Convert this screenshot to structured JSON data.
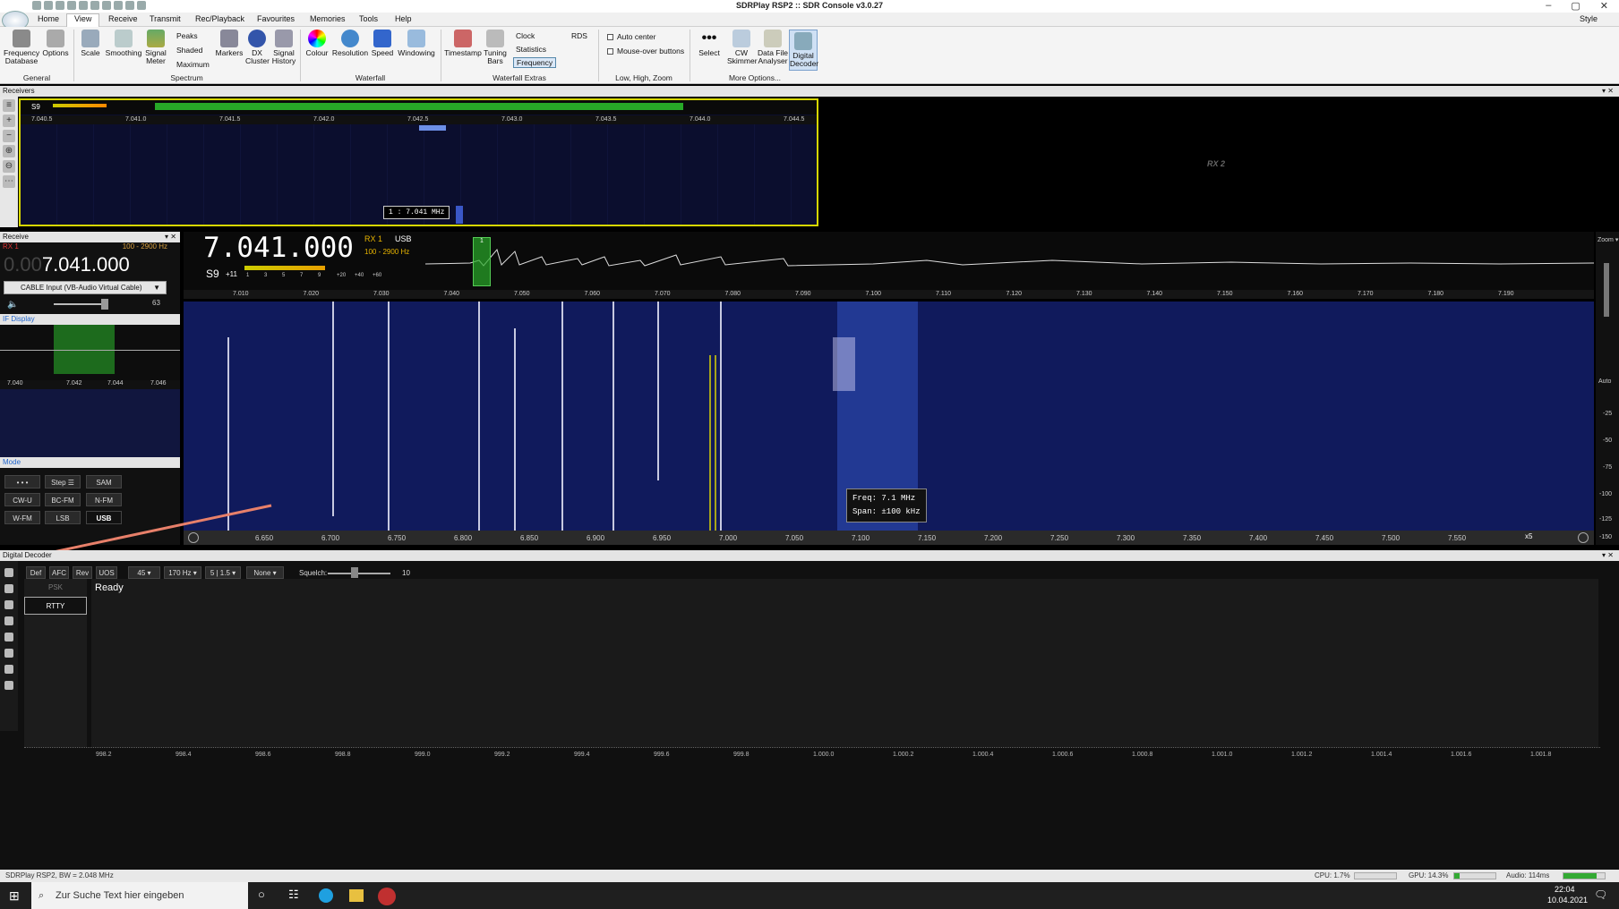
{
  "window": {
    "title": "SDRPlay RSP2 :: SDR Console v3.0.27"
  },
  "menu": {
    "tabs": [
      "Home",
      "View",
      "Receive",
      "Transmit",
      "Rec/Playback",
      "Favourites",
      "Memories",
      "Tools",
      "Help"
    ],
    "active": "View",
    "style_label": "Style"
  },
  "ribbon": {
    "buttons": [
      {
        "label": "Frequency\nDatabase",
        "icon": "database-icon"
      },
      {
        "label": "Options",
        "icon": "gear-icon"
      },
      {
        "label": "Scale",
        "icon": "scale-icon"
      },
      {
        "label": "Smoothing",
        "icon": "smoothing-icon"
      },
      {
        "label": "Signal\nMeter",
        "icon": "meter-icon"
      },
      {
        "label": "Markers",
        "icon": "markers-icon"
      },
      {
        "label": "DX\nCluster",
        "icon": "globe-icon"
      },
      {
        "label": "Signal\nHistory",
        "icon": "history-icon"
      },
      {
        "label": "Colour",
        "icon": "colour-icon"
      },
      {
        "label": "Resolution",
        "icon": "zoom-icon"
      },
      {
        "label": "Speed",
        "icon": "speed-icon"
      },
      {
        "label": "Windowing",
        "icon": "windowing-icon"
      },
      {
        "label": "Timestamp",
        "icon": "timestamp-icon"
      },
      {
        "label": "Tuning\nBars",
        "icon": "tuning-bars-icon"
      },
      {
        "label": "Select",
        "icon": "more-icon"
      },
      {
        "label": "CW\nSkimmer",
        "icon": "cw-skimmer-icon"
      },
      {
        "label": "Data File\nAnalyser",
        "icon": "data-file-icon"
      },
      {
        "label": "Digital\nDecoder",
        "icon": "decoder-icon"
      }
    ],
    "spectrum_small": [
      "Peaks",
      "Shaded",
      "Maximum"
    ],
    "extras_small": [
      "Clock",
      "Statistics",
      "Frequency",
      "RDS"
    ],
    "checks": [
      "Auto center",
      "Mouse-over buttons"
    ],
    "groups": [
      "General",
      "Spectrum",
      "Waterfall",
      "Waterfall Extras",
      "Low, High, Zoom",
      "More Options..."
    ]
  },
  "receivers": {
    "header": "Receivers",
    "rx1": {
      "signal": "S9",
      "scale": [
        "7.040.5",
        "7.041.0",
        "7.041.5",
        "7.042.0",
        "7.042.5",
        "7.043.0",
        "7.043.5",
        "7.044.0",
        "7.044.5"
      ],
      "tooltip": "1 : 7.041 MHz"
    },
    "rx2": {
      "label": "RX 2"
    }
  },
  "receive_panel": {
    "header": "Receive",
    "rx": "RX 1",
    "bandwidth": "100 - 2900 Hz",
    "freq_dim": "0.00",
    "freq": "7.041.000",
    "source": "CABLE Input (VB-Audio Virtual Cable)",
    "volume": "63",
    "if_display": "IF Display",
    "if_scale": [
      "7.040",
      "7.042",
      "7.044",
      "7.046"
    ],
    "mode_header": "Mode",
    "modes": [
      "• • •",
      "Step ☰",
      "SAM",
      "CW-U",
      "BC-FM",
      "N-FM",
      "W-FM",
      "LSB",
      "USB"
    ],
    "active_mode": "USB"
  },
  "spectrum": {
    "freq": "7.041.000",
    "rx": "RX 1",
    "mode": "USB",
    "bw": "100 - 2900 Hz",
    "s_meter": "S9",
    "s_plus": "+11",
    "meter_scale": [
      "1",
      "3",
      "5",
      "7",
      "9",
      "+20",
      "+40",
      "+60"
    ],
    "marker": "1",
    "axis": [
      "7.010",
      "7.020",
      "7.030",
      "7.040",
      "7.050",
      "7.060",
      "7.070",
      "7.080",
      "7.090",
      "7.100",
      "7.110",
      "7.120",
      "7.130",
      "7.140",
      "7.150",
      "7.160",
      "7.170",
      "7.180",
      "7.190"
    ]
  },
  "waterfall": {
    "axis": [
      "6.650",
      "6.700",
      "6.750",
      "6.800",
      "6.850",
      "6.900",
      "6.950",
      "7.000",
      "7.050",
      "7.100",
      "7.150",
      "7.200",
      "7.250",
      "7.300",
      "7.350",
      "7.400",
      "7.450",
      "7.500",
      "7.550"
    ],
    "tip_freq": "Freq:  7.1 MHz",
    "tip_span": "Span: ±100 kHz",
    "zoom": "x5"
  },
  "right_bar": {
    "zoom": "Zoom ▾",
    "auto": "Auto",
    "ticks": [
      "-25",
      "-50",
      "-75",
      "-100",
      "-125",
      "-150"
    ]
  },
  "decoder": {
    "header": "Digital Decoder",
    "buttons": [
      "Def",
      "AFC",
      "Rev",
      "UOS"
    ],
    "dropdowns": [
      "45 ▾",
      "170 Hz ▾",
      "5 | 1.5 ▾",
      "None ▾"
    ],
    "squelch_label": "Squelch:",
    "squelch_value": "10",
    "modes": [
      "PSK",
      "RTTY"
    ],
    "active": "RTTY",
    "status": "Ready",
    "axis": [
      "998.2",
      "998.4",
      "998.6",
      "998.8",
      "999.0",
      "999.2",
      "999.4",
      "999.6",
      "999.8",
      "1.000.0",
      "1.000.2",
      "1.000.4",
      "1.000.6",
      "1.000.8",
      "1.001.0",
      "1.001.2",
      "1.001.4",
      "1.001.6",
      "1.001.8"
    ]
  },
  "status": {
    "device": "SDRPlay RSP2, BW = 2.048 MHz",
    "cpu": "CPU: 1.7%",
    "gpu": "GPU: 14.3%",
    "audio": "Audio: 114ms"
  },
  "taskbar": {
    "search_placeholder": "Zur Suche Text hier eingeben",
    "time": "22:04",
    "date": "10.04.2021"
  }
}
